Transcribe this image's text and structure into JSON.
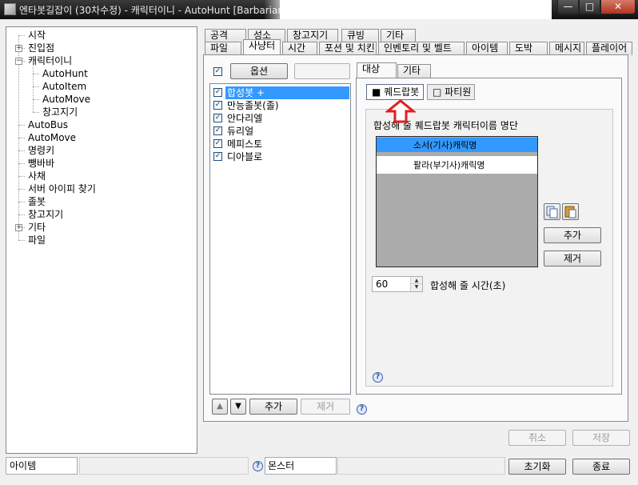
{
  "window": {
    "title": "엔타봇길잡이 (30차수정) - 캐릭터이니 - AutoHunt [Barbarian",
    "min_symbol": "—",
    "max_symbol": "□",
    "close_symbol": "✕"
  },
  "tree": {
    "items": [
      {
        "label": "시작",
        "level": 0
      },
      {
        "label": "진입점",
        "level": 0,
        "expander": "+"
      },
      {
        "label": "캐릭터이니",
        "level": 0,
        "expander": "−"
      },
      {
        "label": "AutoHunt",
        "level": 1
      },
      {
        "label": "AutoItem",
        "level": 1
      },
      {
        "label": "AutoMove",
        "level": 1
      },
      {
        "label": "창고지기",
        "level": 1
      },
      {
        "label": "AutoBus",
        "level": 0
      },
      {
        "label": "AutoMove",
        "level": 0
      },
      {
        "label": "명령키",
        "level": 0
      },
      {
        "label": "뺑바바",
        "level": 0
      },
      {
        "label": "사채",
        "level": 0
      },
      {
        "label": "서버 아이피 찾기",
        "level": 0
      },
      {
        "label": "졸봇",
        "level": 0
      },
      {
        "label": "창고지기",
        "level": 0
      },
      {
        "label": "기타",
        "level": 0,
        "expander": "+"
      },
      {
        "label": "파일",
        "level": 0
      }
    ]
  },
  "tabs_row1": [
    "공격",
    "성소",
    "창고지기",
    "큐빙",
    "기타"
  ],
  "tabs_row2": [
    "파일",
    "사냥터",
    "시간",
    "포션 및 치킨",
    "인벤토리 및 벨트",
    "아이템",
    "도박",
    "메시지",
    "플레이어"
  ],
  "left_panel": {
    "enable_checked": "✓",
    "options_button": "옵션",
    "characters": [
      {
        "name": "합성봇 +",
        "checked": "✓",
        "selected": true
      },
      {
        "name": "만능졸봇(졸)",
        "checked": "✓"
      },
      {
        "name": "안다리엘",
        "checked": "✓"
      },
      {
        "name": "듀리얼",
        "checked": "✓"
      },
      {
        "name": "메피스토",
        "checked": "✓"
      },
      {
        "name": "디아블로",
        "checked": "✓"
      }
    ],
    "up_arrow": "▲",
    "down_arrow": "▼",
    "add_button": "추가",
    "remove_button": "제거"
  },
  "right_panel": {
    "tabs": [
      "대상",
      "기타"
    ],
    "subtabs": [
      {
        "label": "■ 퀘드랍봇",
        "selected": true
      },
      {
        "label": "□ 파티원",
        "selected": false
      }
    ],
    "group_label": "합성해 줄 퀘드랍봇 캐릭터이름 명단",
    "names": [
      "소서(기사)캐릭명",
      "팔라(부기사)캐릭명"
    ],
    "add_button": "추가",
    "remove_button": "제거",
    "time_value": "60",
    "time_label": "합성해 줄 시간(초)",
    "help": "?"
  },
  "bottom": {
    "cancel_button": "취소",
    "save_button": "저장",
    "item_label": "아이템",
    "monster_label": "몬스터",
    "reset_button": "초기화",
    "close_button": "종료"
  },
  "colors": {
    "selection": "#3399ff",
    "arrow": "#e02020",
    "titlebar": "#1a1a1a"
  }
}
